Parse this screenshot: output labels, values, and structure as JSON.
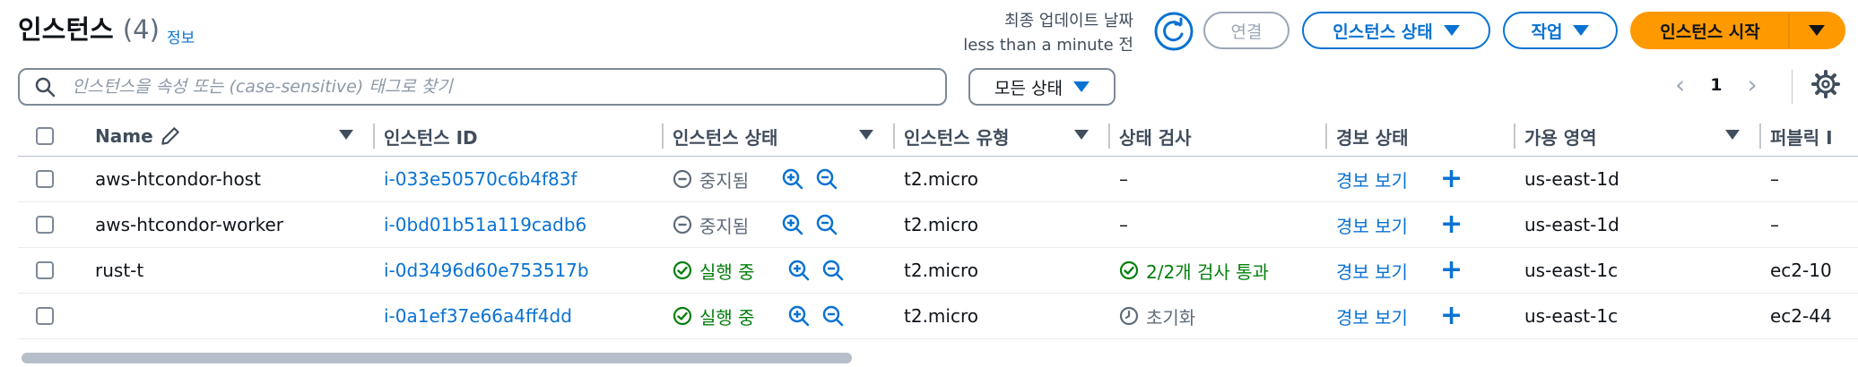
{
  "header": {
    "title": "인스턴스",
    "count": "(4)",
    "info_link": "정보",
    "update_label": "최종 업데이트 날짜",
    "update_value": "less than a minute 전"
  },
  "toolbar": {
    "connect_label": "연결",
    "instance_state_label": "인스턴스 상태",
    "actions_label": "작업",
    "launch_label": "인스턴스 시작"
  },
  "search": {
    "placeholder": "인스턴스을 속성 또는 (case-sensitive) 태그로 찾기",
    "value": ""
  },
  "filter": {
    "label": "모든 상태"
  },
  "pagination": {
    "prev": "‹",
    "page": "1",
    "next": "›"
  },
  "table": {
    "columns": [
      "Name",
      "인스턴스 ID",
      "인스턴스 상태",
      "인스턴스 유형",
      "상태 검사",
      "경보 상태",
      "가용 영역",
      "퍼블릭 I"
    ],
    "rows": [
      {
        "name": "aws-htcondor-host",
        "id": "i-033e50570c6b4f83f",
        "state": "중지됨",
        "state_kind": "stopped",
        "type": "t2.micro",
        "check": "–",
        "check_kind": "none",
        "alarm": "경보 보기",
        "az": "us-east-1d",
        "public": "–"
      },
      {
        "name": "aws-htcondor-worker",
        "id": "i-0bd01b51a119cadb6",
        "state": "중지됨",
        "state_kind": "stopped",
        "type": "t2.micro",
        "check": "–",
        "check_kind": "none",
        "alarm": "경보 보기",
        "az": "us-east-1d",
        "public": "–"
      },
      {
        "name": "rust-t",
        "id": "i-0d3496d60e753517b",
        "state": "실행 중",
        "state_kind": "running",
        "type": "t2.micro",
        "check": "2/2개 검사 통과",
        "check_kind": "passed",
        "alarm": "경보 보기",
        "az": "us-east-1c",
        "public": "ec2-10"
      },
      {
        "name": "",
        "id": "i-0a1ef37e66a4ff4dd",
        "state": "실행 중",
        "state_kind": "running",
        "type": "t2.micro",
        "check": "초기화",
        "check_kind": "init",
        "alarm": "경보 보기",
        "az": "us-east-1c",
        "public": "ec2-44"
      }
    ]
  },
  "colors": {
    "link": "#0972d3",
    "running": "#037f0c",
    "stopped": "#5f6b7a",
    "primary_button": "#ff9900"
  }
}
